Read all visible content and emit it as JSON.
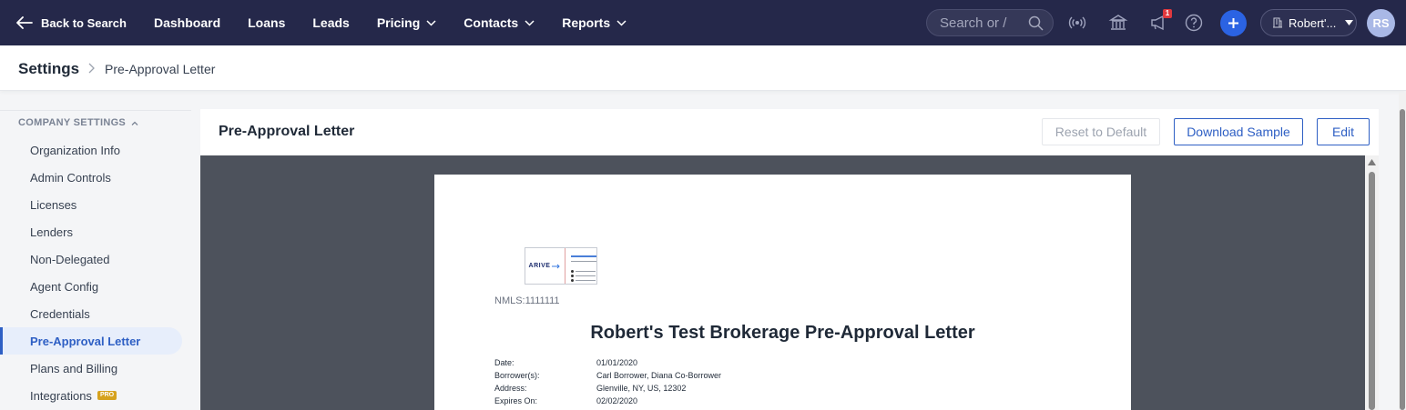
{
  "topnav": {
    "back_label": "Back to Search",
    "links": [
      {
        "label": "Dashboard",
        "dropdown": false
      },
      {
        "label": "Loans",
        "dropdown": false
      },
      {
        "label": "Leads",
        "dropdown": false
      },
      {
        "label": "Pricing",
        "dropdown": true
      },
      {
        "label": "Contacts",
        "dropdown": true
      },
      {
        "label": "Reports",
        "dropdown": true
      }
    ],
    "search_placeholder": "Search or /",
    "notification_count": "1",
    "company_label": "Robert'...",
    "avatar_initials": "RS"
  },
  "breadcrumb": {
    "root": "Settings",
    "current": "Pre-Approval Letter"
  },
  "sidebar": {
    "section_title": "COMPANY SETTINGS",
    "items": [
      {
        "label": "Organization Info",
        "active": false
      },
      {
        "label": "Admin Controls",
        "active": false
      },
      {
        "label": "Licenses",
        "active": false
      },
      {
        "label": "Lenders",
        "active": false
      },
      {
        "label": "Non-Delegated",
        "active": false
      },
      {
        "label": "Agent Config",
        "active": false
      },
      {
        "label": "Credentials",
        "active": false
      },
      {
        "label": "Pre-Approval Letter",
        "active": true
      },
      {
        "label": "Plans and Billing",
        "active": false
      },
      {
        "label": "Integrations",
        "active": false,
        "badge": "PRO"
      }
    ]
  },
  "main": {
    "title": "Pre-Approval Letter",
    "buttons": {
      "reset": "Reset to Default",
      "download": "Download Sample",
      "edit": "Edit"
    }
  },
  "letter": {
    "logo_text": "ARIVE",
    "nmls": "NMLS:1111111",
    "title": "Robert's Test Brokerage Pre-Approval Letter",
    "fields": [
      {
        "label": "Date:",
        "value": "01/01/2020"
      },
      {
        "label": "Borrower(s):",
        "value": "Carl Borrower, Diana Co-Borrower"
      },
      {
        "label": "Address:",
        "value": "Glenville, NY, US, 12302"
      },
      {
        "label": "Expires On:",
        "value": "02/02/2020"
      }
    ]
  },
  "colors": {
    "nav_bg": "#25284a",
    "accent": "#2e5fc4",
    "viewer_bg": "#4d525c"
  }
}
